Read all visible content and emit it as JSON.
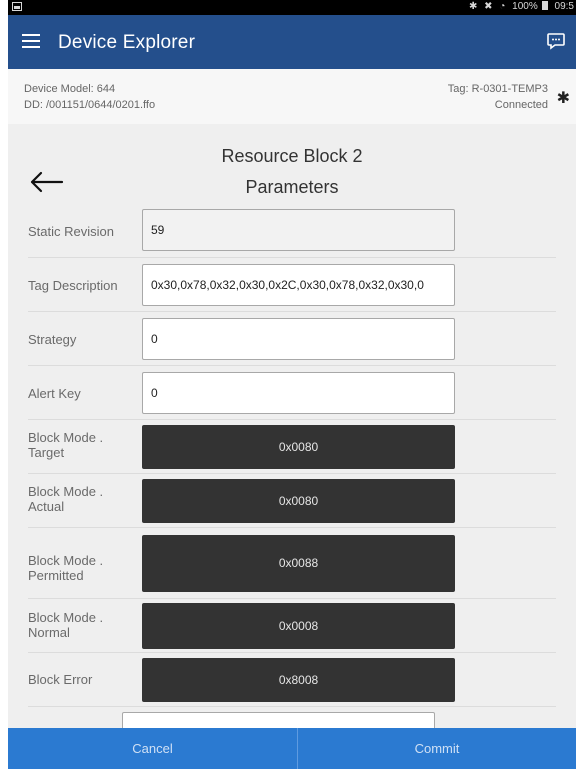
{
  "status_bar": {
    "right_text": "100%",
    "clock": "09:5"
  },
  "app_bar": {
    "title": "Device Explorer"
  },
  "device_info": {
    "model": "Device Model: 644",
    "dd": "DD: /001151/0644/0201.ffo",
    "tag": "Tag: R-0301-TEMP3",
    "connection": "Connected"
  },
  "block": {
    "title": "Resource Block 2",
    "subtitle": "Parameters"
  },
  "params": [
    {
      "label": "Static Revision",
      "value": "59",
      "kind": "readonly"
    },
    {
      "label": "Tag Description",
      "value": "0x30,0x78,0x32,0x30,0x2C,0x30,0x78,0x32,0x30,0",
      "kind": "input"
    },
    {
      "label": "Strategy",
      "value": "0",
      "kind": "input"
    },
    {
      "label": "Alert Key",
      "value": "0",
      "kind": "input"
    },
    {
      "label": "Block Mode . Target",
      "value": "0x0080",
      "kind": "button"
    },
    {
      "label": "Block Mode . Actual",
      "value": "0x0080",
      "kind": "button"
    },
    {
      "label": "Block Mode . Permitted",
      "value": "0x0088",
      "kind": "button"
    },
    {
      "label": "Block Mode . Normal",
      "value": "0x0008",
      "kind": "button"
    },
    {
      "label": "Block Error",
      "value": "0x8008",
      "kind": "button"
    }
  ],
  "footer": {
    "cancel": "Cancel",
    "commit": "Commit"
  },
  "colors": {
    "app_bar": "#244f8c",
    "bottom_bar": "#2b7ad1",
    "mode_button": "#333333"
  }
}
